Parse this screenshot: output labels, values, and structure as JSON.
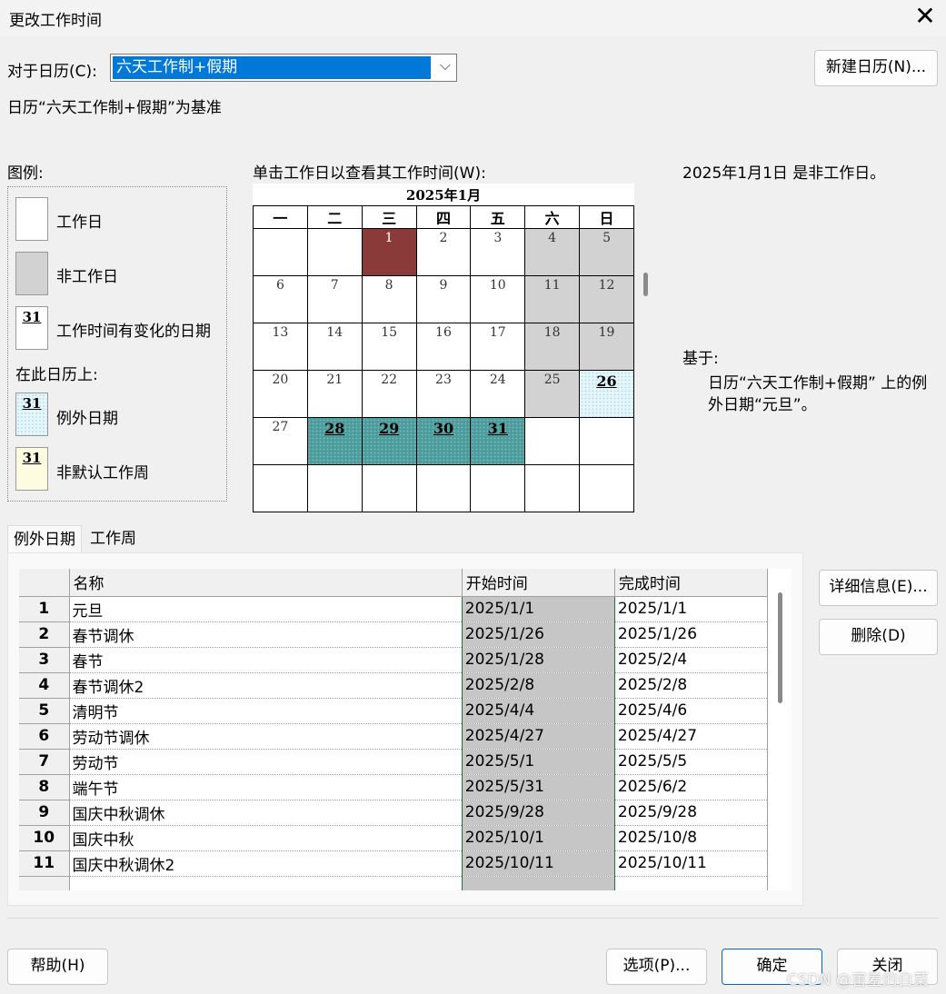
{
  "window": {
    "title": "更改工作时间"
  },
  "calendar_selector": {
    "label": "对于日历(C):",
    "value": "六天工作制+假期",
    "new_button": "新建日历(N)..."
  },
  "base_text": "日历“六天工作制+假期”为基准",
  "legend": {
    "heading": "图例:",
    "working_day": "工作日",
    "nonworking_day": "非工作日",
    "changed_day": "工作时间有变化的日期",
    "on_this_calendar": "在此日历上:",
    "exception_day": "例外日期",
    "nondefault_week": "非默认工作周",
    "swatch_number": "31"
  },
  "calendar": {
    "instruction": "单击工作日以查看其工作时间(W):",
    "month_title": "2025年1月",
    "weekdays": [
      "一",
      "二",
      "三",
      "四",
      "五",
      "六",
      "日"
    ],
    "rows": [
      [
        "",
        "",
        "1",
        "2",
        "3",
        "4",
        "5"
      ],
      [
        "6",
        "7",
        "8",
        "9",
        "10",
        "11",
        "12"
      ],
      [
        "13",
        "14",
        "15",
        "16",
        "17",
        "18",
        "19"
      ],
      [
        "20",
        "21",
        "22",
        "23",
        "24",
        "25",
        "26"
      ],
      [
        "27",
        "28",
        "29",
        "30",
        "31",
        "",
        ""
      ],
      [
        "",
        "",
        "",
        "",
        "",
        "",
        ""
      ]
    ]
  },
  "info": {
    "status": "2025年1月1日 是非工作日。",
    "based_on_label": "基于:",
    "based_on_text": "日历“六天工作制+假期” 上的例外日期“元旦”。"
  },
  "tabs": [
    "例外日期",
    "工作周"
  ],
  "exceptions_table": {
    "columns": [
      "名称",
      "开始时间",
      "完成时间"
    ],
    "rows": [
      {
        "num": "1",
        "name": "元旦",
        "start": "2025/1/1",
        "finish": "2025/1/1"
      },
      {
        "num": "2",
        "name": "春节调休",
        "start": "2025/1/26",
        "finish": "2025/1/26"
      },
      {
        "num": "3",
        "name": "春节",
        "start": "2025/1/28",
        "finish": "2025/2/4"
      },
      {
        "num": "4",
        "name": "春节调休2",
        "start": "2025/2/8",
        "finish": "2025/2/8"
      },
      {
        "num": "5",
        "name": "清明节",
        "start": "2025/4/4",
        "finish": "2025/4/6"
      },
      {
        "num": "6",
        "name": "劳动节调休",
        "start": "2025/4/27",
        "finish": "2025/4/27"
      },
      {
        "num": "7",
        "name": "劳动节",
        "start": "2025/5/1",
        "finish": "2025/5/5"
      },
      {
        "num": "8",
        "name": "端午节",
        "start": "2025/5/31",
        "finish": "2025/6/2"
      },
      {
        "num": "9",
        "name": "国庆中秋调休",
        "start": "2025/9/28",
        "finish": "2025/9/28"
      },
      {
        "num": "10",
        "name": "国庆中秋",
        "start": "2025/10/1",
        "finish": "2025/10/8"
      },
      {
        "num": "11",
        "name": "国庆中秋调休2",
        "start": "2025/10/11",
        "finish": "2025/10/11"
      }
    ]
  },
  "side_buttons": {
    "details": "详细信息(E)...",
    "delete": "删除(D)"
  },
  "footer": {
    "help": "帮助(H)",
    "options": "选项(P)...",
    "ok": "确定",
    "close": "关闭"
  },
  "watermark": "CSDN @害羞的白菜",
  "colors": {
    "accent": "#0078d7",
    "today": "#8b3a3a",
    "selected_range": "#4c9c9c",
    "exception": "#e4f6fb",
    "nonworking": "#d2d2d2"
  }
}
